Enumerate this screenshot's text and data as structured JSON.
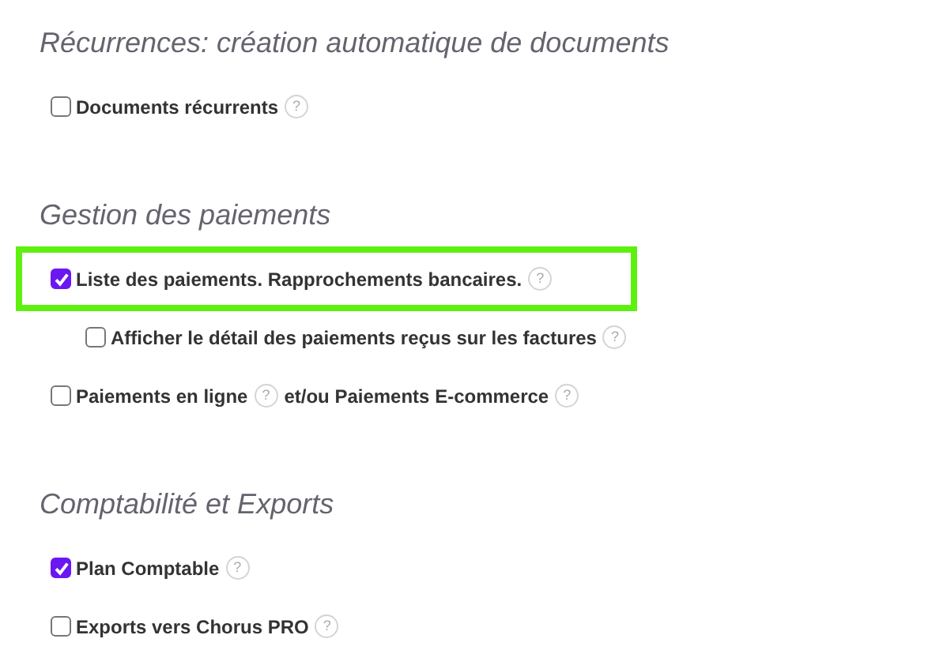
{
  "sections": [
    {
      "title": "Récurrences: création automatique de documents",
      "options": [
        {
          "checked": false,
          "highlighted": false,
          "parts": [
            {
              "text": "Documents récurrents",
              "help": "?"
            }
          ]
        }
      ]
    },
    {
      "title": "Gestion des paiements",
      "options": [
        {
          "checked": true,
          "highlighted": true,
          "parts": [
            {
              "text": "Liste des paiements. Rapprochements bancaires.",
              "help": "?"
            }
          ],
          "children": [
            {
              "checked": false,
              "highlighted": false,
              "parts": [
                {
                  "text": "Afficher le détail des paiements reçus sur les factures",
                  "help": "?"
                }
              ]
            }
          ]
        },
        {
          "checked": false,
          "highlighted": false,
          "parts": [
            {
              "text": "Paiements en ligne",
              "help": "?"
            },
            {
              "text": "et/ou Paiements E-commerce",
              "help": "?"
            }
          ]
        }
      ]
    },
    {
      "title": "Comptabilité et Exports",
      "options": [
        {
          "checked": true,
          "highlighted": false,
          "parts": [
            {
              "text": "Plan Comptable",
              "help": "?"
            }
          ]
        },
        {
          "checked": false,
          "highlighted": false,
          "parts": [
            {
              "text": "Exports vers Chorus PRO",
              "help": "?"
            }
          ]
        }
      ]
    }
  ]
}
